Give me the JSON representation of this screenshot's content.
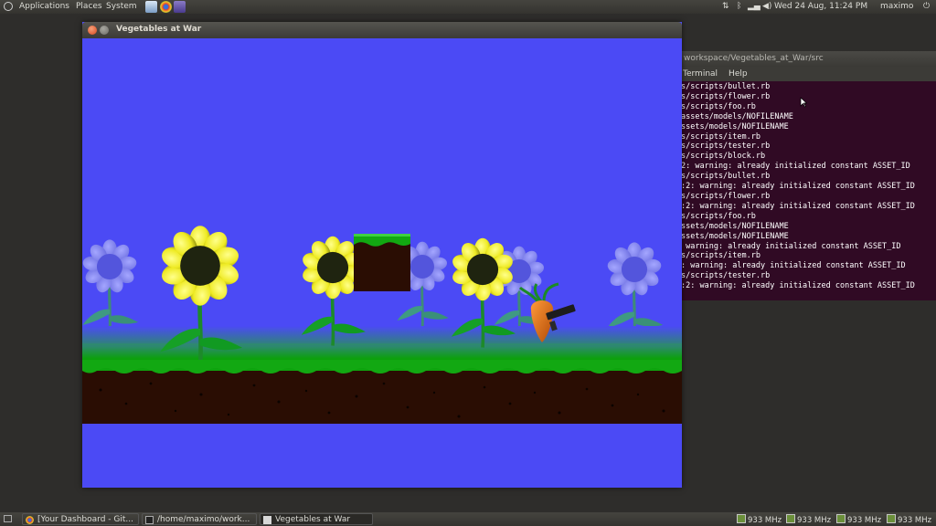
{
  "top_panel": {
    "menus": [
      "Applications",
      "Places",
      "System"
    ],
    "datetime": "Wed 24 Aug, 11:24 PM",
    "user": "maximo"
  },
  "game_window": {
    "title": "Vegetables at War"
  },
  "terminal": {
    "title_fragment": "workspace/Vegetables_at_War/src",
    "menu": [
      "Terminal",
      "Help"
    ],
    "lines": [
      "s/scripts/bullet.rb",
      "s/scripts/flower.rb",
      "s/scripts/foo.rb",
      "assets/models/NOFILENAME",
      "ssets/models/NOFILENAME",
      "s/scripts/item.rb",
      "s/scripts/tester.rb",
      "s/scripts/block.rb",
      "2: warning: already initialized constant ASSET_ID",
      "s/scripts/bullet.rb",
      ":2: warning: already initialized constant ASSET_ID",
      "s/scripts/flower.rb",
      ":2: warning: already initialized constant ASSET_ID",
      "s/scripts/foo.rb",
      "ssets/models/NOFILENAME",
      "ssets/models/NOFILENAME",
      " warning: already initialized constant ASSET_ID",
      "s/scripts/item.rb",
      ": warning: already initialized constant ASSET_ID",
      "s/scripts/tester.rb",
      ":2: warning: already initialized constant ASSET_ID"
    ]
  },
  "taskbar": {
    "tasks": [
      "[Your Dashboard - Git...",
      "/home/maximo/work...",
      "Vegetables at War"
    ],
    "cpu_freqs": [
      "933 MHz",
      "933 MHz",
      "933 MHz",
      "933 MHz"
    ]
  },
  "colors": {
    "sky": "#4b4af5",
    "grass": "#0aa10a",
    "soil": "#2a0d03",
    "terminal_bg": "#300a24",
    "flower_petal": "#f0ee2a",
    "flower_center": "#1f2410"
  }
}
